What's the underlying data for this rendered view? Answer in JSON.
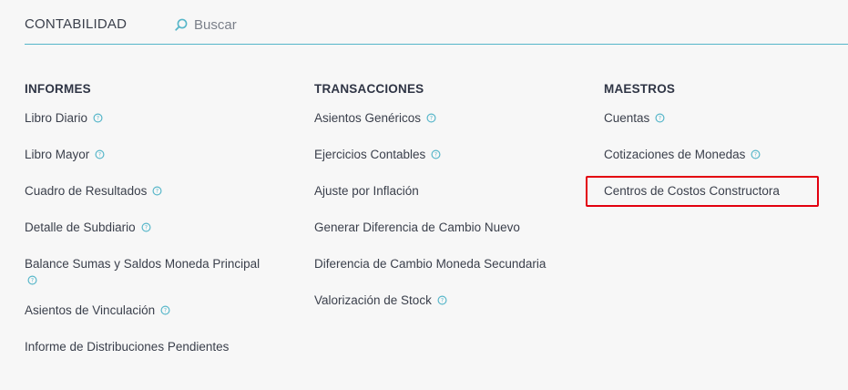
{
  "header": {
    "module_title": "CONTABILIDAD",
    "search_placeholder": "Buscar",
    "accent_color": "#56b6c9"
  },
  "columns": {
    "informes": {
      "heading": "INFORMES",
      "items": [
        {
          "label": "Libro Diario",
          "help": true
        },
        {
          "label": "Libro Mayor",
          "help": true
        },
        {
          "label": "Cuadro de Resultados",
          "help": true
        },
        {
          "label": "Detalle de Subdiario",
          "help": true
        },
        {
          "label": "Balance Sumas y Saldos Moneda Principal",
          "help": true
        },
        {
          "label": "Asientos de Vinculación",
          "help": true
        },
        {
          "label": "Informe de Distribuciones Pendientes",
          "help": false
        }
      ]
    },
    "transacciones": {
      "heading": "TRANSACCIONES",
      "items": [
        {
          "label": "Asientos Genéricos",
          "help": true
        },
        {
          "label": "Ejercicios Contables",
          "help": true
        },
        {
          "label": "Ajuste por Inflación",
          "help": false
        },
        {
          "label": "Generar Diferencia de Cambio Nuevo",
          "help": false
        },
        {
          "label": "Diferencia de Cambio Moneda Secundaria",
          "help": false
        },
        {
          "label": "Valorización de Stock",
          "help": true
        }
      ]
    },
    "maestros": {
      "heading": "MAESTROS",
      "items": [
        {
          "label": "Cuentas",
          "help": true
        },
        {
          "label": "Cotizaciones de Monedas",
          "help": true
        },
        {
          "label": "Centros de Costos Constructora",
          "help": false
        }
      ]
    }
  },
  "highlight_color": "#e3000f"
}
